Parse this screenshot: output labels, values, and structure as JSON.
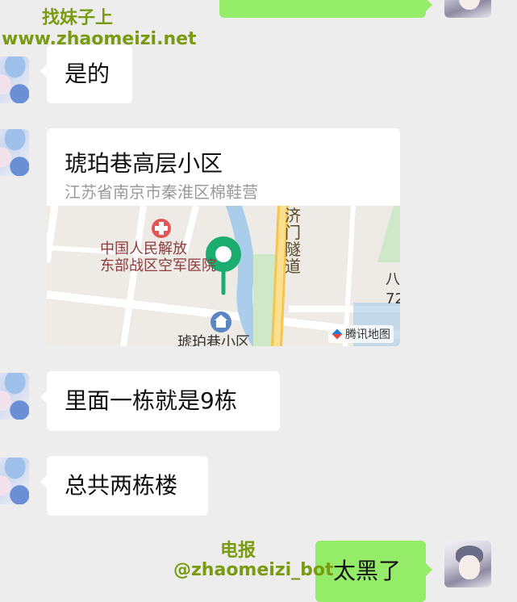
{
  "watermark_top": {
    "line1": "找妹子上",
    "line2": "www.zhaomeizi.net"
  },
  "watermark_bottom": {
    "line1": "电报",
    "line2": "@zhaomeizi_bot"
  },
  "messages": [
    {
      "text": "是的",
      "side": "left"
    },
    {
      "text": "里面一栋就是9栋",
      "side": "left"
    },
    {
      "text": "总共两栋楼",
      "side": "left"
    },
    {
      "text": "太黑了",
      "side": "right"
    }
  ],
  "location": {
    "title": "琥珀巷高层小区",
    "address": "江苏省南京市秦淮区棉鞋营",
    "map": {
      "poi_hospital": "中国人民解放\n东部战区空军医院",
      "poi_bottom": "琥珀巷小区",
      "road": "济门隧道",
      "edge_label_1": "八",
      "edge_label_2": "72",
      "provider": "腾讯地图"
    }
  },
  "colors": {
    "background": "#ededed",
    "bubble_received": "#ffffff",
    "bubble_sent": "#95ec69",
    "map_pin": "#1aad6f",
    "watermark": "#7a9a12"
  }
}
